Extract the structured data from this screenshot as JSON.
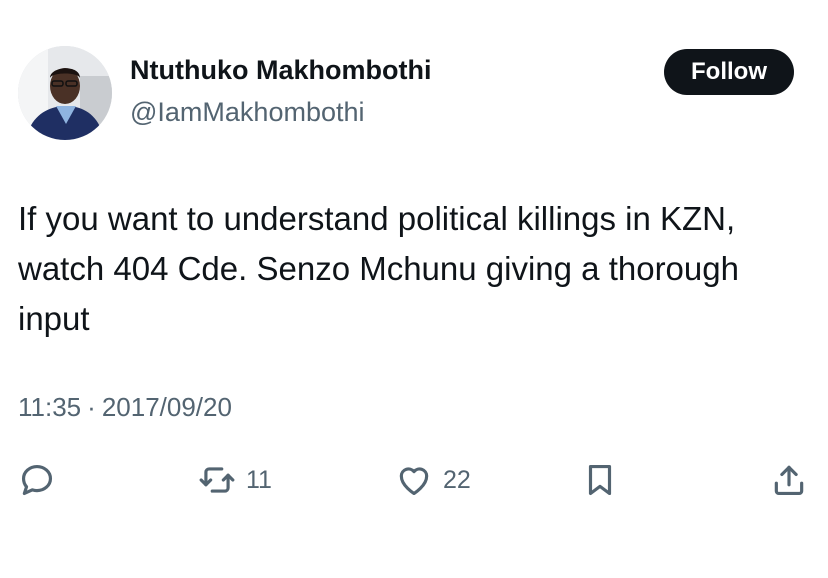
{
  "author": {
    "display_name": "Ntuthuko Makhombothi",
    "handle": "@IamMakhombothi"
  },
  "follow_button": {
    "label": "Follow"
  },
  "tweet": {
    "text": "If you want to understand political killings in KZN, watch 404 Cde. Senzo Mchunu giving a thorough input",
    "time": "11:35",
    "separator": "·",
    "date": "2017/09/20"
  },
  "actions": {
    "reply": {
      "icon": "reply-icon"
    },
    "retweet": {
      "icon": "retweet-icon",
      "count": "11"
    },
    "like": {
      "icon": "heart-icon",
      "count": "22"
    },
    "bookmark": {
      "icon": "bookmark-icon"
    },
    "share": {
      "icon": "share-icon"
    }
  },
  "colors": {
    "text_primary": "#0f1419",
    "text_secondary": "#536471",
    "follow_bg": "#0f1419",
    "follow_text": "#ffffff",
    "background": "#ffffff"
  }
}
